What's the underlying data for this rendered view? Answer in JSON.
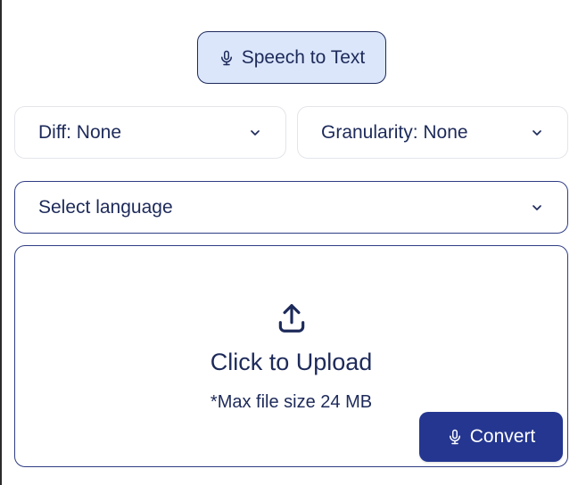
{
  "mode": {
    "label": "Speech to Text",
    "icon": "microphone-icon"
  },
  "filters": {
    "diff": {
      "label": "Diff: None"
    },
    "granularity": {
      "label": "Granularity: None"
    }
  },
  "language": {
    "label": "Select language"
  },
  "upload": {
    "icon": "upload-icon",
    "title": "Click to Upload",
    "note": "*Max file size 24 MB"
  },
  "convert": {
    "label": "Convert",
    "icon": "microphone-icon"
  },
  "colors": {
    "accent": "#243690",
    "pill_bg": "#dbe6fb",
    "text": "#1d2a5a"
  }
}
